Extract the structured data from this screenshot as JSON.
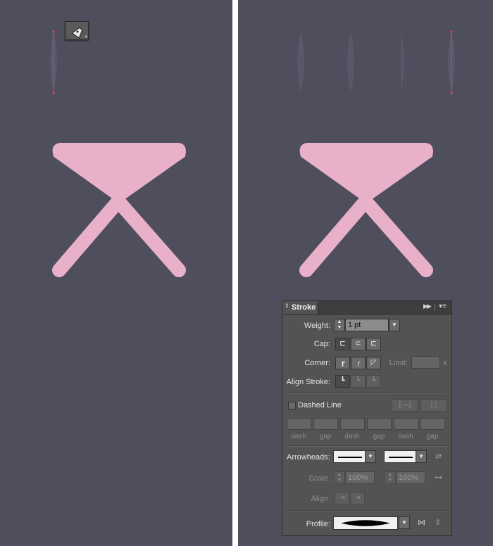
{
  "canvas": {
    "background": "#4f4e5d",
    "divider_color": "#ffffff",
    "shape_color": "#e9b1c9",
    "path_color": "#e04060"
  },
  "tooltip": {
    "icon": "pen-tool-icon"
  },
  "stroke_panel": {
    "tab_title": "Stroke",
    "weight": {
      "label": "Weight:",
      "value": "1 pt"
    },
    "cap": {
      "label": "Cap:",
      "options": [
        "butt-cap-icon",
        "round-cap-icon",
        "projecting-cap-icon"
      ]
    },
    "corner": {
      "label": "Corner:",
      "options": [
        "miter-join-icon",
        "round-join-icon",
        "bevel-join-icon"
      ],
      "limit_label": "Limit:",
      "limit_suffix": "x"
    },
    "align_stroke": {
      "label": "Align Stroke:",
      "options": [
        "align-center-icon",
        "align-inside-icon",
        "align-outside-icon"
      ]
    },
    "dashed_line": {
      "label": "Dashed Line",
      "checked": false
    },
    "dash_labels": [
      "dash",
      "gap",
      "dash",
      "gap",
      "dash",
      "gap"
    ],
    "arrowheads": {
      "label": "Arrowheads:"
    },
    "scale": {
      "label": "Scale:",
      "start": "100%",
      "end": "100%"
    },
    "align": {
      "label": "Align:"
    },
    "profile": {
      "label": "Profile:"
    }
  }
}
